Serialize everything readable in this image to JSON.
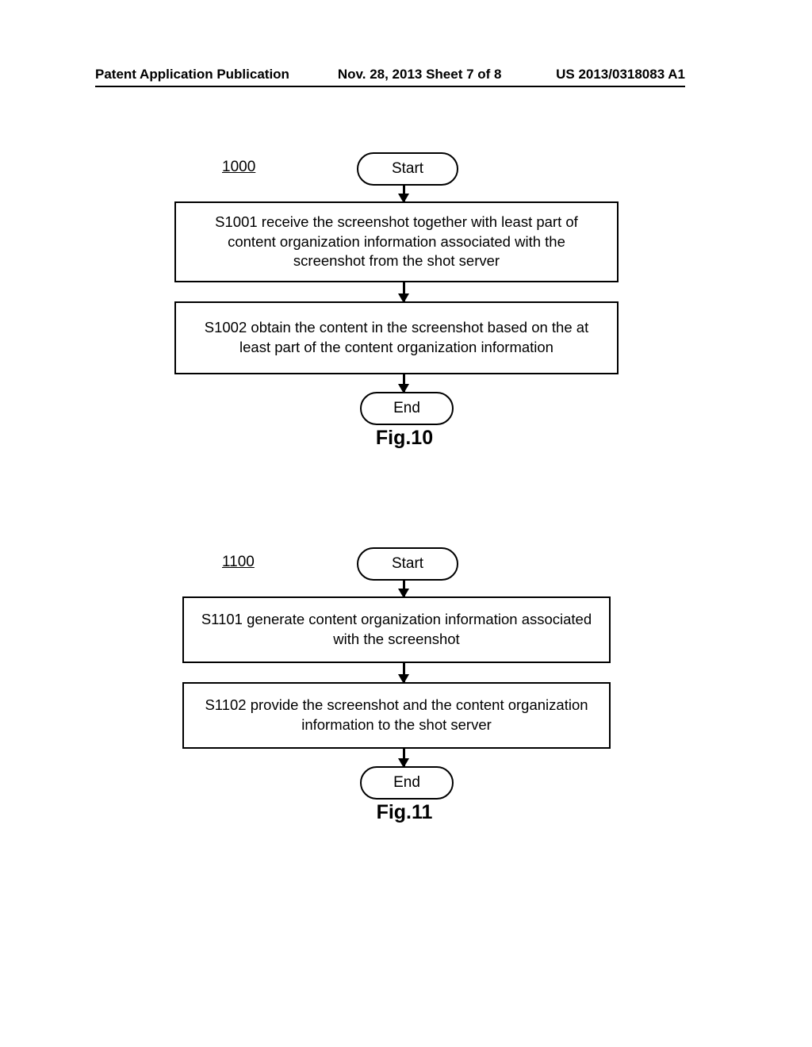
{
  "header": {
    "left": "Patent Application Publication",
    "center": "Nov. 28, 2013  Sheet 7 of 8",
    "right": "US 2013/0318083 A1"
  },
  "fig10": {
    "ref": "1000",
    "start": "Start",
    "end": "End",
    "label": "Fig.10",
    "step1": "S1001 receive the screenshot together with least part of content organization information associated with the screenshot from the shot server",
    "step2": "S1002  obtain the content in the screenshot based on the at least part of the content organization information"
  },
  "fig11": {
    "ref": "1100",
    "start": "Start",
    "end": "End",
    "label": "Fig.11",
    "step1": "S1101 generate content organization information associated with the screenshot",
    "step2": "S1102  provide the screenshot and the content organization information to the shot server"
  }
}
